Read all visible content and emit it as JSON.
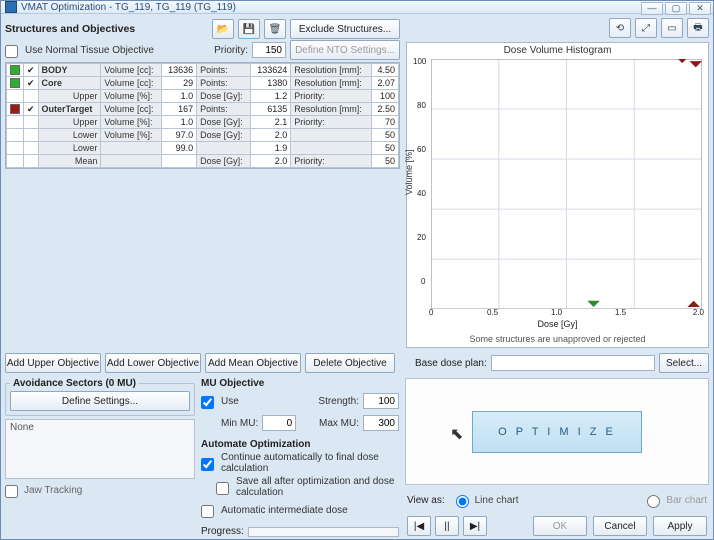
{
  "window": {
    "title": "VMAT Optimization - TG_119, TG_119 (TG_119)"
  },
  "toolbar_right_icons": [
    "⟲",
    "⤢",
    "▭",
    "🖶"
  ],
  "section_title": "Structures and Objectives",
  "header_icons": [
    "📂",
    "💾",
    "🗑"
  ],
  "exclude_btn": "Exclude Structures...",
  "nto": {
    "checkbox_label": "Use Normal Tissue Objective",
    "priority_label": "Priority:",
    "priority": "150",
    "define_btn": "Define NTO Settings..."
  },
  "grid": {
    "body": {
      "name": "BODY",
      "vol_cc_lbl": "Volume [cc]:",
      "vol_cc": "13636",
      "points_lbl": "Points:",
      "points": "133624",
      "res_lbl": "Resolution [mm]:",
      "res": "4.50"
    },
    "core": {
      "name": "Core",
      "vol_cc_lbl": "Volume [cc]:",
      "vol_cc": "29",
      "points_lbl": "Points:",
      "points": "1380",
      "res_lbl": "Resolution [mm]:",
      "res": "2.07",
      "upper": {
        "lbl": "Upper",
        "vp_lbl": "Volume [%]:",
        "vp": "1.0",
        "dg_lbl": "Dose [Gy]:",
        "dg": "1.2",
        "pr_lbl": "Priority:",
        "pr": "100"
      }
    },
    "outer": {
      "name": "OuterTarget",
      "vol_cc_lbl": "Volume [cc]:",
      "vol_cc": "167",
      "points_lbl": "Points:",
      "points": "6135",
      "res_lbl": "Resolution [mm]:",
      "res": "2.50",
      "upper": {
        "lbl": "Upper",
        "vp_lbl": "Volume [%]:",
        "vp": "1.0",
        "dg_lbl": "Dose [Gy]:",
        "dg": "2.1",
        "pr_lbl": "Priority:",
        "pr": "70"
      },
      "lower": {
        "lbl": "Lower",
        "vp_lbl": "Volume [%]:",
        "vp": "97.0",
        "dg_lbl": "Dose [Gy]:",
        "dg": "2.0",
        "pr_lbl": "",
        "pr": "50"
      },
      "lower2": {
        "lbl": "Lower",
        "vp": "99.0",
        "dg": "1.9",
        "pr": "50"
      },
      "mean": {
        "lbl": "Mean",
        "dg_lbl": "Dose [Gy]:",
        "dg": "2.0",
        "pr_lbl": "Priority:",
        "pr": "50"
      }
    }
  },
  "obj_buttons": {
    "add_upper": "Add Upper Objective",
    "add_lower": "Add Lower Objective",
    "add_mean": "Add Mean Objective",
    "delete": "Delete Objective"
  },
  "avoidance": {
    "title": "Avoidance Sectors (0 MU)",
    "define": "Define Settings...",
    "none": "None"
  },
  "mu": {
    "title": "MU Objective",
    "use": "Use",
    "strength_lbl": "Strength:",
    "strength": "100",
    "min_lbl": "Min MU:",
    "min": "0",
    "max_lbl": "Max MU:",
    "max": "300"
  },
  "auto": {
    "title": "Automate Optimization",
    "c1": "Continue automatically to final dose calculation",
    "c2": "Save all after optimization and dose calculation",
    "c3": "Automatic intermediate dose"
  },
  "progress_lbl": "Progress:",
  "jaw": "Jaw Tracking",
  "chart": {
    "title": "Dose Volume Histogram",
    "ylabel": "Volume [%]",
    "xlabel": "Dose [Gy]",
    "footer": "Some structures are unapproved or rejected"
  },
  "chart_data": {
    "type": "line",
    "xlim": [
      0,
      2
    ],
    "ylim": [
      0,
      100
    ],
    "xticks": [
      "0",
      "0.5",
      "1.0",
      "1.5",
      "2.0"
    ],
    "yticks": [
      "0",
      "20",
      "40",
      "60",
      "80",
      "100"
    ],
    "markers": [
      {
        "series": "Core",
        "color": "#2f8a2f",
        "shape": "tri-up",
        "x": 1.2,
        "y": 1
      },
      {
        "series": "OuterTarget",
        "color": "#8a1a1a",
        "shape": "tri-down",
        "x": 2.1,
        "y": 1
      },
      {
        "series": "OuterTarget",
        "color": "#8a1a1a",
        "shape": "tri-up",
        "x": 2.0,
        "y": 97
      },
      {
        "series": "OuterTarget",
        "color": "#8a1a1a",
        "shape": "tri-up",
        "x": 1.9,
        "y": 99
      }
    ]
  },
  "base": {
    "label": "Base dose plan:",
    "value": "",
    "select": "Select..."
  },
  "optimize": "O P T I M I Z E",
  "viewas": {
    "label": "View as:",
    "line": "Line chart",
    "bar": "Bar chart"
  },
  "footer": {
    "ok": "OK",
    "cancel": "Cancel",
    "apply": "Apply"
  },
  "play": [
    "|◀",
    "||",
    "▶|"
  ]
}
